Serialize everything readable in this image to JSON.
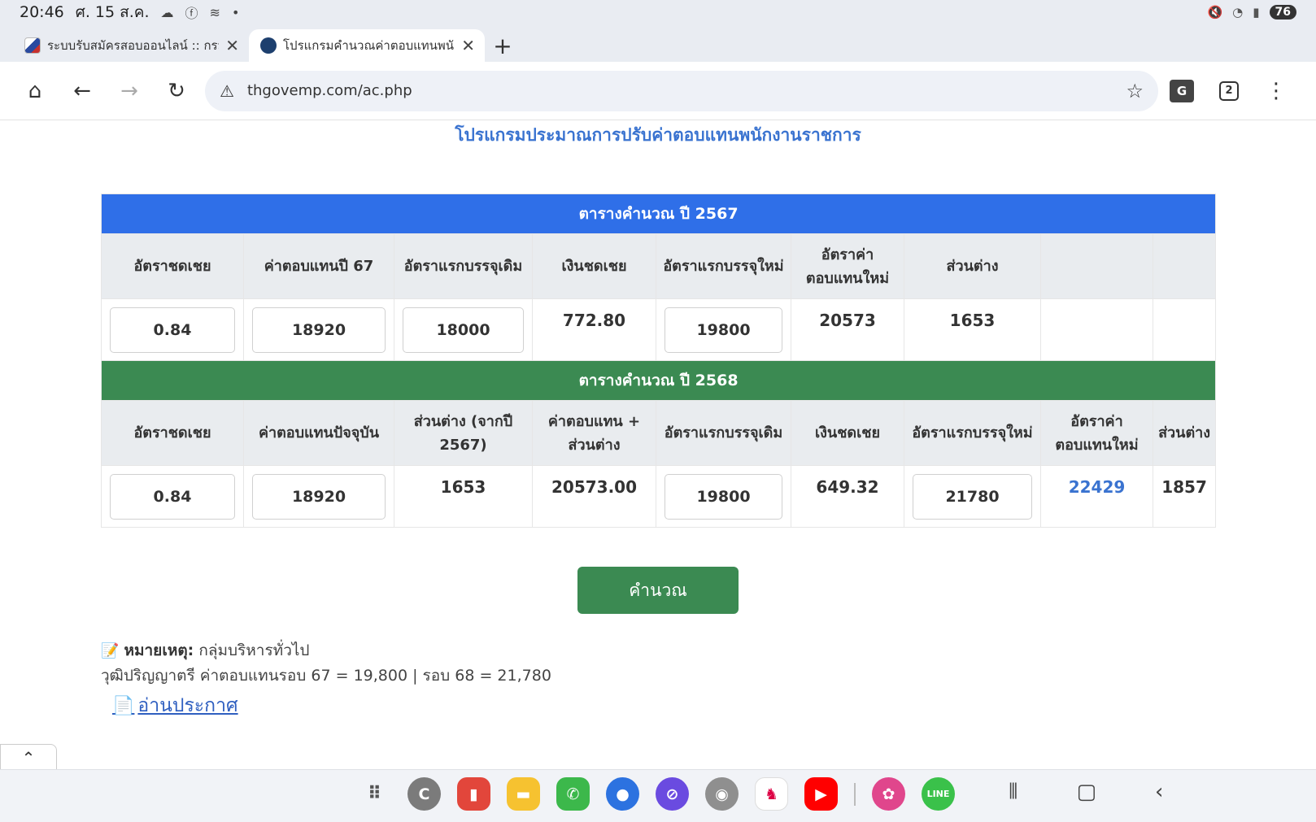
{
  "status_bar": {
    "time": "20:46",
    "date": "ศ. 15 ส.ค.",
    "battery": "76"
  },
  "tabs": [
    {
      "title": "ระบบรับสมัครสอบออนไลน์ :: กรม"
    },
    {
      "title": "โปรแกรมคำนวณค่าตอบแทนพนัก"
    }
  ],
  "toolbar": {
    "url": "thgovemp.com/ac.php",
    "tab_count": "2"
  },
  "page": {
    "title": "โปรแกรมประมาณการปรับค่าตอบแทนพนักงานราชการ"
  },
  "table_2567": {
    "heading": "ตารางคำนวณ ปี 2567",
    "headers": [
      "อัตราชดเชย",
      "ค่าตอบแทนปี 67",
      "อัตราแรกบรรจุเดิม",
      "เงินชดเชย",
      "อัตราแรกบรรจุใหม่",
      "อัตราค่าตอบแทนใหม่",
      "ส่วนต่าง",
      "",
      ""
    ],
    "inputs": {
      "rate": "0.84",
      "pay_67": "18920",
      "old_start": "18000",
      "new_start": "19800"
    },
    "values": {
      "compensation": "772.80",
      "new_pay": "20573",
      "difference": "1653"
    }
  },
  "table_2568": {
    "heading": "ตารางคำนวณ ปี 2568",
    "headers": [
      "อัตราชดเชย",
      "ค่าตอบแทนปัจจุบัน",
      "ส่วนต่าง (จากปี 2567)",
      "ค่าตอบแทน + ส่วนต่าง",
      "อัตราแรกบรรจุเดิม",
      "เงินชดเชย",
      "อัตราแรกบรรจุใหม่",
      "อัตราค่าตอบแทนใหม่",
      "ส่วนต่าง"
    ],
    "inputs": {
      "rate": "0.84",
      "current_pay": "18920",
      "old_start": "19800",
      "new_start": "21780"
    },
    "values": {
      "diff_from_2567": "1653",
      "pay_plus_diff": "20573.00",
      "compensation": "649.32",
      "new_pay": "22429",
      "difference": "1857"
    }
  },
  "calc_button": "คำนวณ",
  "note": {
    "label": "หมายเหตุ:",
    "text": "กลุ่มบริหารทั่วไป",
    "detail": "วุฒิปริญญาตรี ค่าตอบแทนรอบ 67 = 19,800 | รอบ 68 = 21,780"
  },
  "announce_link": "อ่านประกาศ",
  "colors": {
    "head_blue": "#2f6fe8",
    "head_green": "#3b8a52",
    "accent_blue": "#3a73d0"
  }
}
